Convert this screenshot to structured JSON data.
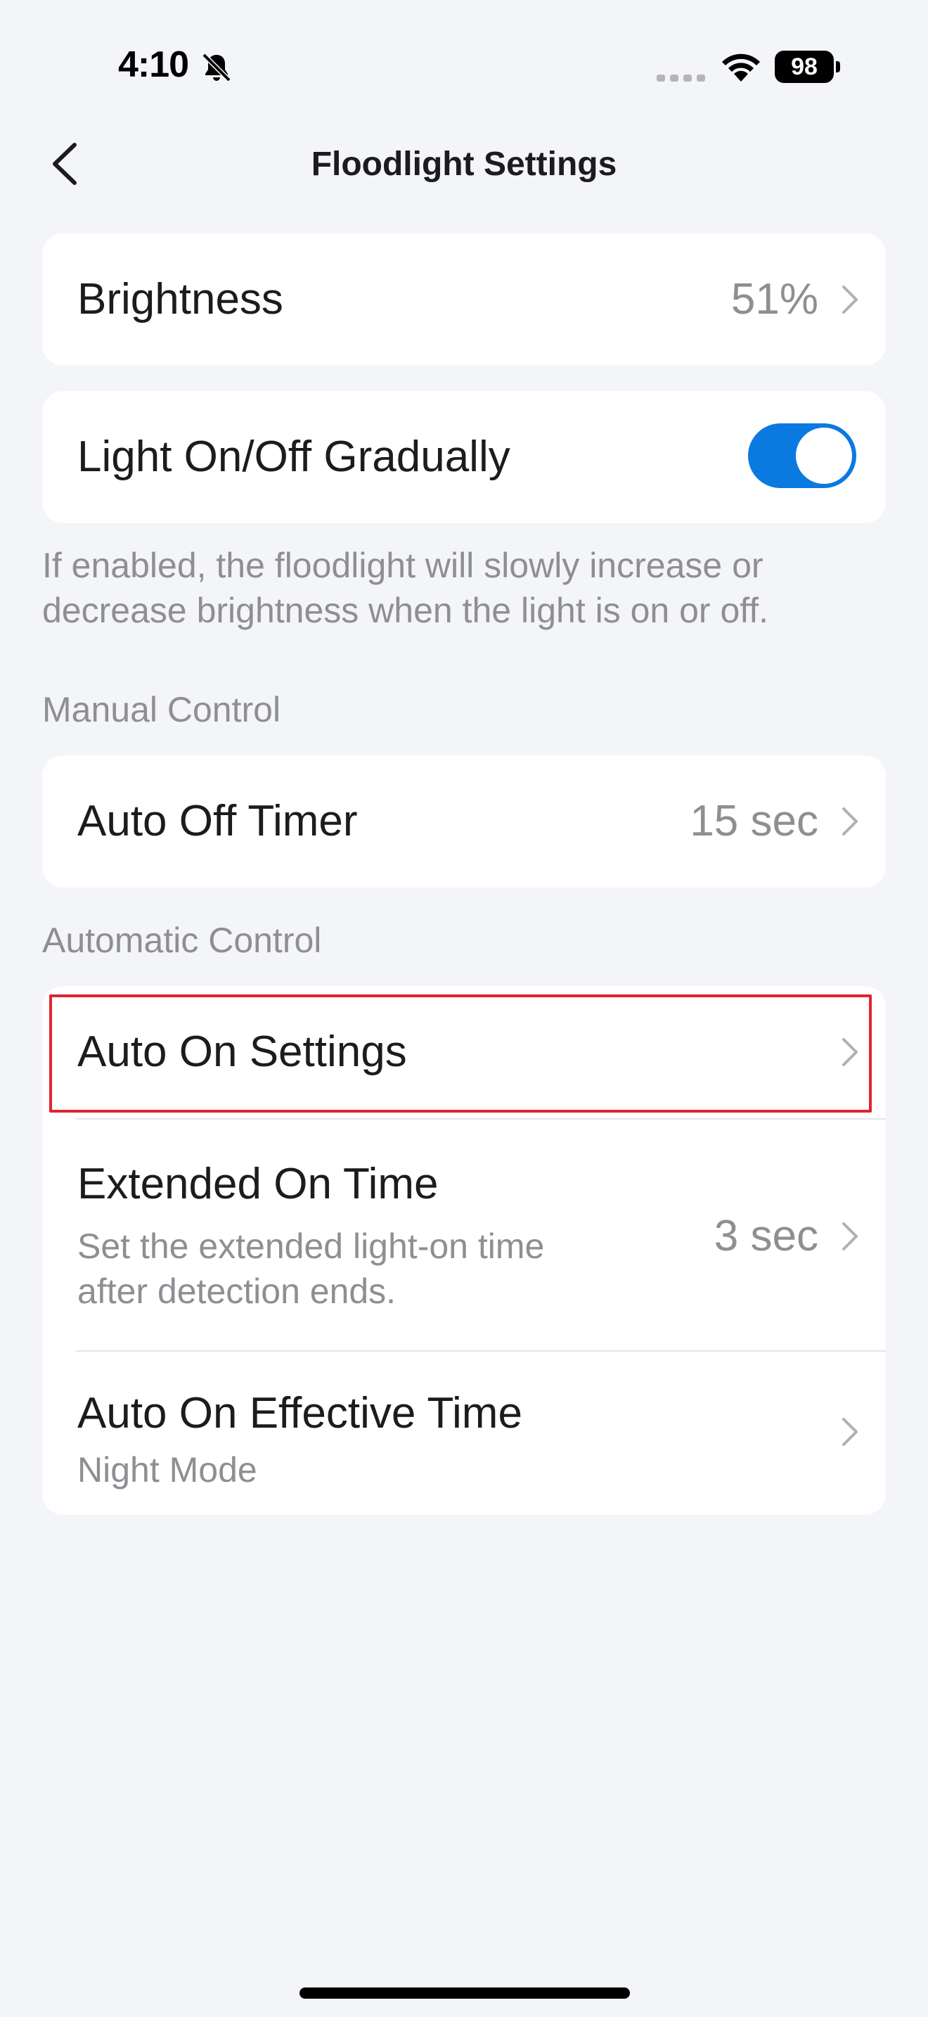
{
  "status_bar": {
    "time": "4:10",
    "battery": "98",
    "icons": [
      "bell-slash-icon",
      "signal-icon",
      "wifi-icon",
      "battery-icon"
    ]
  },
  "nav": {
    "title": "Floodlight Settings",
    "back_icon": "chevron-left-icon"
  },
  "brightness": {
    "label": "Brightness",
    "value": "51%"
  },
  "gradual": {
    "label": "Light On/Off Gradually",
    "enabled": true,
    "toggle_color": "#0a7ae0",
    "helper": "If enabled, the floodlight will slowly increase or decrease brightness when the light is on or off."
  },
  "manual_control": {
    "header": "Manual Control",
    "auto_off_timer": {
      "label": "Auto Off Timer",
      "value": "15 sec"
    }
  },
  "automatic_control": {
    "header": "Automatic Control",
    "auto_on_settings": {
      "label": "Auto On Settings"
    },
    "extended_on_time": {
      "label": "Extended On Time",
      "subtitle_line1": "Set the extended light-on time",
      "subtitle_line2": "after detection ends.",
      "value": "3 sec"
    },
    "auto_on_effective_time": {
      "label": "Auto On Effective Time",
      "subtitle": "Night Mode"
    }
  },
  "highlight_color": "#e0242f"
}
